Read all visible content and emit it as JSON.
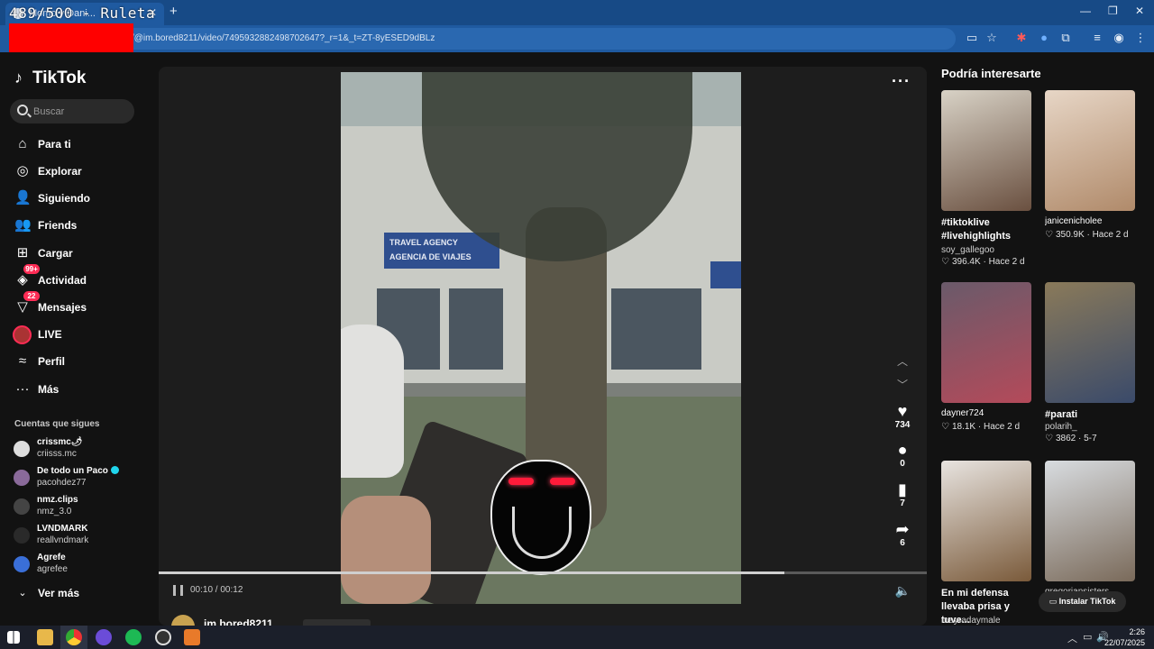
{
  "browser": {
    "overlay_counter": "489/500 - Ruleta",
    "tab_title": "Momo y Dani...",
    "tab_close": "✕",
    "new_tab": "+",
    "url": "/@im.bored8211/video/7495932882498702647?_r=1&_t=ZT-8yESED9dBLz",
    "window_controls": [
      "—",
      "❐",
      "✕"
    ]
  },
  "sidebar": {
    "logo": "TikTok",
    "search_placeholder": "Buscar",
    "nav": [
      {
        "label": "Para ti",
        "icon": "home-icon",
        "glyph": "⌂"
      },
      {
        "label": "Explorar",
        "icon": "compass-icon",
        "glyph": "◎"
      },
      {
        "label": "Siguiendo",
        "icon": "following-icon",
        "glyph": "👤"
      },
      {
        "label": "Friends",
        "icon": "friends-icon",
        "glyph": "👥"
      },
      {
        "label": "Cargar",
        "icon": "upload-icon",
        "glyph": "⊞"
      },
      {
        "label": "Actividad",
        "icon": "activity-icon",
        "glyph": "◈",
        "badge": "99+"
      },
      {
        "label": "Mensajes",
        "icon": "messages-icon",
        "glyph": "▽",
        "badge": "22"
      },
      {
        "label": "LIVE",
        "icon": "live-avatar-icon",
        "glyph": ""
      },
      {
        "label": "Perfil",
        "icon": "profile-icon",
        "glyph": "≈"
      },
      {
        "label": "Más",
        "icon": "more-dots-icon",
        "glyph": "···"
      }
    ],
    "following_title": "Cuentas que sigues",
    "following": [
      {
        "name": "crissmc🌶",
        "user": "criisss.mc",
        "color": "#dddddd",
        "verified": false
      },
      {
        "name": "De todo un Paco",
        "user": "pacohdez77",
        "color": "#8a6a9a",
        "verified": true
      },
      {
        "name": "nmz.clips",
        "user": "nmz_3.0",
        "color": "#444444",
        "verified": false
      },
      {
        "name": "LVNDMARK",
        "user": "reallvndmark",
        "color": "#2a2a2a",
        "verified": false
      },
      {
        "name": "Agrefe",
        "user": "agrefee",
        "color": "#3a6fd8",
        "verified": false
      }
    ],
    "see_more": "Ver más"
  },
  "video": {
    "time": "00:10 / 00:12",
    "progress": 0.815,
    "sign_line1": "TRAVEL AGENCY",
    "sign_line2": "AGENCIA DE VIAJES",
    "actions": {
      "likes": "734",
      "comments": "0",
      "saves": "7",
      "shares": "6"
    },
    "author": "im.bored8211"
  },
  "recommendations": {
    "title": "Podría interesarte",
    "cards": [
      {
        "caption": "#tiktoklive #livehighlights",
        "bold": true,
        "user": "soy_gallegoo",
        "likes": "396.4K",
        "when": "Hace 2 d",
        "colors": [
          "#d8d2c6",
          "#6a5040"
        ]
      },
      {
        "caption": "janicenicholee",
        "bold": false,
        "user": "",
        "likes": "350.9K",
        "when": "Hace 2 d",
        "colors": [
          "#e7d6c6",
          "#b08a6a"
        ]
      },
      {
        "caption": "dayner724",
        "bold": false,
        "user": "",
        "likes": "18.1K",
        "when": "Hace 2 d",
        "colors": [
          "#6a5a6a",
          "#b44a5a"
        ]
      },
      {
        "caption": "#parati",
        "bold": true,
        "user": "polarih_",
        "likes": "3862",
        "when": "5-7",
        "colors": [
          "#8a7a5a",
          "#3a4a6a"
        ]
      },
      {
        "caption": "En mi defensa llevaba prisa y tuve...",
        "bold": true,
        "user": "mayradaymale",
        "likes": "",
        "when": "",
        "colors": [
          "#e8e4e0",
          "#7a5a3a"
        ]
      },
      {
        "caption": "",
        "bold": false,
        "user": "gregoriansisters",
        "likes": "",
        "when": "",
        "colors": [
          "#d8dce0",
          "#7a6a5a"
        ]
      }
    ],
    "install": "Instalar TikTok"
  },
  "taskbar": {
    "time": "2:26",
    "date": "22/07/2025"
  }
}
